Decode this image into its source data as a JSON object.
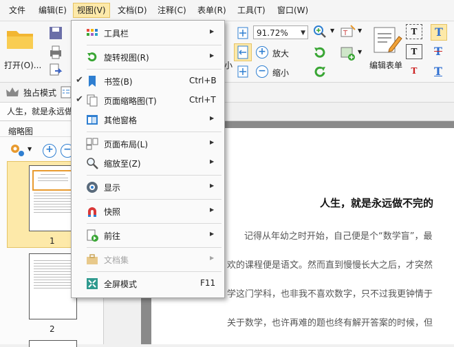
{
  "menubar": {
    "items": [
      "文件",
      "编辑(E)",
      "视图(V)",
      "文档(D)",
      "注释(C)",
      "表单(R)",
      "工具(T)",
      "窗口(W)"
    ]
  },
  "ribbon": {
    "open_label": "打开(O)...",
    "zoom_value": "91.72%",
    "zoom_in_label": "放大",
    "zoom_out_label": "缩小",
    "edit_form_label": "编辑表单",
    "partial_label": "小"
  },
  "modebar": {
    "label": "独占模式"
  },
  "tabbar": {
    "doc_tab": "人生，就是永远做"
  },
  "thumbnails": {
    "title": "缩略图",
    "pages": [
      "1",
      "2"
    ]
  },
  "document": {
    "title": "人生，就是永远做不完的",
    "lines": [
      "记得从年幼之时开始，自己便是个“数学盲”，最",
      "欢的课程便是语文。然而直到慢慢长大之后，才突然",
      "学这门学科，也非我不喜欢数字，只不过我更钟情于",
      "关于数学，也许再难的题也终有解开答案的时候，但"
    ]
  },
  "view_menu": {
    "items": [
      {
        "label": "工具栏",
        "shortcut": "",
        "submenu": true,
        "checked": false,
        "disabled": false,
        "icon": "toolbar-grid-icon"
      },
      {
        "label": "旋转视图(R)",
        "shortcut": "",
        "submenu": true,
        "checked": false,
        "disabled": false,
        "icon": "rotate-view-icon"
      },
      {
        "label": "书签(B)",
        "shortcut": "Ctrl+B",
        "submenu": false,
        "checked": true,
        "disabled": false,
        "icon": "bookmark-icon"
      },
      {
        "label": "页面缩略图(T)",
        "shortcut": "Ctrl+T",
        "submenu": false,
        "checked": true,
        "disabled": false,
        "icon": "page-thumbnails-icon"
      },
      {
        "label": "其他窗格",
        "shortcut": "",
        "submenu": true,
        "checked": false,
        "disabled": false,
        "icon": "other-panes-icon"
      },
      {
        "label": "页面布局(L)",
        "shortcut": "",
        "submenu": true,
        "checked": false,
        "disabled": false,
        "icon": "page-layout-icon"
      },
      {
        "label": "缩放至(Z)",
        "shortcut": "",
        "submenu": true,
        "checked": false,
        "disabled": false,
        "icon": "zoom-to-icon"
      },
      {
        "label": "显示",
        "shortcut": "",
        "submenu": true,
        "checked": false,
        "disabled": false,
        "icon": "display-eye-icon"
      },
      {
        "label": "快照",
        "shortcut": "",
        "submenu": true,
        "checked": false,
        "disabled": false,
        "icon": "snapshot-magnet-icon"
      },
      {
        "label": "前往",
        "shortcut": "",
        "submenu": true,
        "checked": false,
        "disabled": false,
        "icon": "goto-page-icon"
      },
      {
        "label": "文档集",
        "shortcut": "",
        "submenu": true,
        "checked": false,
        "disabled": true,
        "icon": "document-set-icon"
      },
      {
        "label": "全屏模式",
        "shortcut": "F11",
        "submenu": false,
        "checked": false,
        "disabled": false,
        "icon": "fullscreen-icon"
      }
    ]
  },
  "colors": {
    "active_menu_bg": "#fde9a9",
    "accent_blue": "#2f7fd1",
    "accent_green": "#3aa635",
    "thumb_selected": "#fde9a9"
  }
}
